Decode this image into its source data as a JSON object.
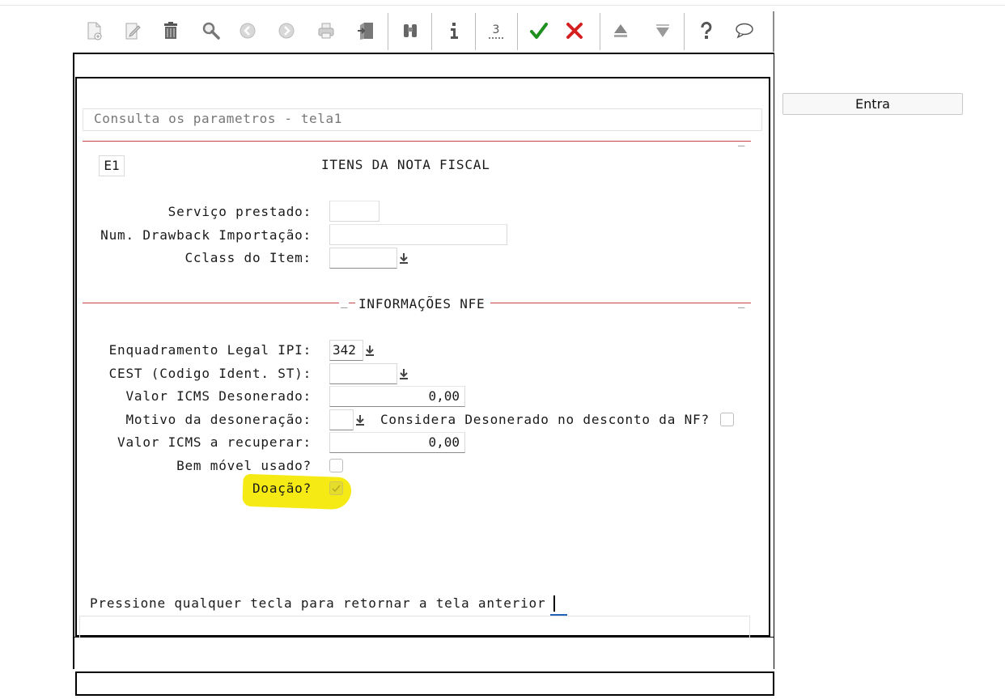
{
  "toolbar": {
    "buttons": [
      {
        "icon": "new-document-icon"
      },
      {
        "icon": "edit-icon"
      },
      {
        "icon": "trash-icon"
      },
      {
        "icon": "search-icon"
      },
      {
        "icon": "previous-icon"
      },
      {
        "icon": "next-icon"
      },
      {
        "icon": "print-icon"
      },
      {
        "icon": "exit-door-icon"
      },
      {
        "icon": "binoculars-icon"
      },
      {
        "icon": "info-icon"
      },
      {
        "icon": "sequence-icon"
      },
      {
        "icon": "confirm-check-icon",
        "color": "#1f8f1f"
      },
      {
        "icon": "cancel-x-icon",
        "color": "#d42020"
      },
      {
        "icon": "page-up-icon"
      },
      {
        "icon": "page-down-icon"
      },
      {
        "icon": "help-icon"
      },
      {
        "icon": "chat-icon"
      }
    ]
  },
  "screen": {
    "title": "Consulta os parametros - tela1",
    "company": "E1",
    "section_title": "ITENS DA NOTA FISCAL",
    "nfe_section_title": "INFORMAÇÕES NFE",
    "dash": "_"
  },
  "fields": {
    "servico_prestado": {
      "label": "Serviço prestado:",
      "value": ""
    },
    "num_drawback": {
      "label": "Num. Drawback Importação:",
      "value": ""
    },
    "cclass_item": {
      "label": "Cclass do Item:",
      "value": ""
    },
    "enquadramento_ipi": {
      "label": "Enquadramento Legal IPI:",
      "value": "342"
    },
    "cest": {
      "label": "CEST (Codigo Ident. ST):",
      "value": ""
    },
    "valor_icms_desonerado": {
      "label": "Valor ICMS Desonerado:",
      "value": "0,00"
    },
    "motivo_desoneracao": {
      "label": "Motivo da desoneração:",
      "value": ""
    },
    "considera_desonerado": {
      "label": "Considera Desonerado no desconto da NF?",
      "checked": false
    },
    "valor_icms_recuperar": {
      "label": "Valor ICMS a recuperar:",
      "value": "0,00"
    },
    "bem_movel_usado": {
      "label": "Bem móvel usado?",
      "checked": false
    },
    "doacao": {
      "label": "Doação?",
      "checked": true,
      "disabled": true
    }
  },
  "footer": {
    "prompt": "Pressione qualquer tecla para retornar a tela anterior"
  },
  "side": {
    "entra_label": "Entra"
  },
  "colors": {
    "red_rule": "#c8424a",
    "highlight": "#f5ea13",
    "cursor_underline": "#1e63b8"
  }
}
